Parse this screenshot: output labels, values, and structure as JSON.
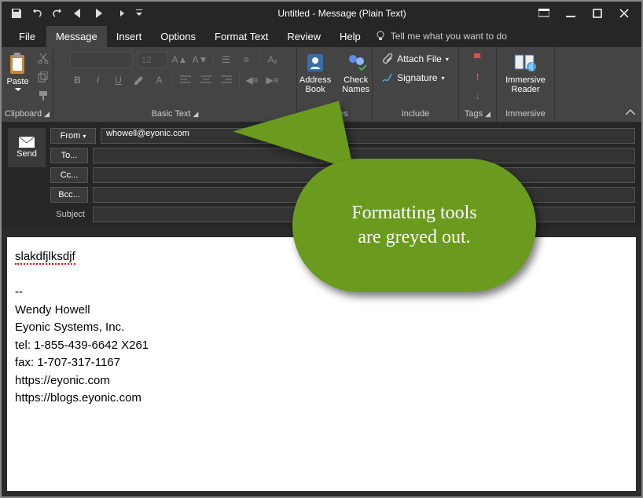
{
  "title": "Untitled  -  Message (Plain Text)",
  "menubar": {
    "file": "File",
    "message": "Message",
    "insert": "Insert",
    "options": "Options",
    "format": "Format Text",
    "review": "Review",
    "help": "Help",
    "tellme": "Tell me what you want to do"
  },
  "ribbon": {
    "paste": "Paste",
    "clipboard": "Clipboard",
    "basictext": "Basic Text",
    "fontsize": "12",
    "addressbook": "Address\nBook",
    "checknames": "Check\nNames",
    "names": "Names",
    "attachfile": "Attach File",
    "signature": "Signature",
    "include": "Include",
    "tags": "Tags",
    "immersive_reader": "Immersive\nReader",
    "immersive": "Immersive"
  },
  "fields": {
    "send": "Send",
    "from": "From",
    "to": "To...",
    "cc": "Cc...",
    "bcc": "Bcc...",
    "subject": "Subject",
    "from_value": "whowell@eyonic.com"
  },
  "body": {
    "line1": "slakdfjlksdjf",
    "sig1": "--",
    "sig2": "Wendy Howell",
    "sig3": "Eyonic Systems, Inc.",
    "sig4": "tel: 1-855-439-6642 X261",
    "sig5": "fax: 1-707-317-1167",
    "sig6": "https://eyonic.com",
    "sig7": "https://blogs.eyonic.com"
  },
  "callout": {
    "line1": "Formatting tools",
    "line2": "are greyed out."
  }
}
